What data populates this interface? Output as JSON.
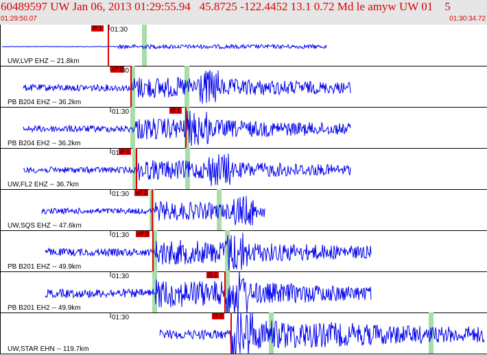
{
  "header": {
    "title": "60489597 UW Jan 06, 2013 01:29:55.94   45.8725 -122.4452 13.1 0.72 Md le amyw UW 01    5",
    "start_time": "01:29:50.07",
    "end_time": "01:30:34.72"
  },
  "colors": {
    "header_bg": "#e6e6e6",
    "header_text": "#dd0000",
    "trace": "#0000ee",
    "pick": "#e00000",
    "window": "#a8dca8"
  },
  "traces": [
    {
      "station": "UW,LVP EHZ -- 21.8km",
      "tick_label": "01:30",
      "pick_label": "iP 1",
      "amplitude": "low"
    },
    {
      "station": "PB B204 EHZ -- 36.2km",
      "tick_label": "01:30",
      "pick_label": "eP 0",
      "amplitude": "medium"
    },
    {
      "station": "PB B204 EH2 -- 36.2km",
      "tick_label": "01:30",
      "pick_label": "iS 1",
      "amplitude": "medium"
    },
    {
      "station": "UW,FL2 EHZ -- 36.7km",
      "tick_label": "01:30",
      "pick_label": "iP 0",
      "amplitude": "medium"
    },
    {
      "station": "UW,SQS EHZ -- 47.6km",
      "tick_label": "01:30",
      "pick_label": "eP 2",
      "amplitude": "medium"
    },
    {
      "station": "PB B201 EHZ -- 49.9km",
      "tick_label": "01:30",
      "pick_label": "eP 0",
      "amplitude": "medium"
    },
    {
      "station": "PB B201 EH2 -- 49.9km",
      "tick_label": "01:30",
      "pick_label": "iS 1",
      "amplitude": "high"
    },
    {
      "station": "UW,STAR EHN -- 119.7km",
      "tick_label": "01:30",
      "pick_label": "iS 1",
      "amplitude": "high"
    }
  ]
}
